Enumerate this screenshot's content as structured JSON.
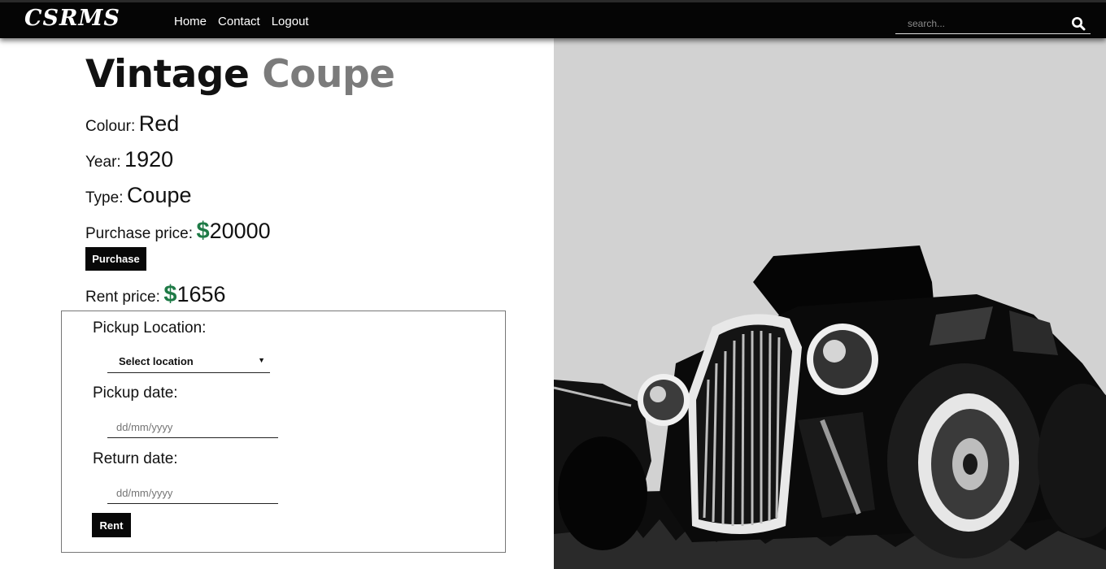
{
  "navbar": {
    "brand": "CSRMS",
    "links": [
      "Home",
      "Contact",
      "Logout"
    ],
    "search_placeholder": "search..."
  },
  "car": {
    "title_part1": "Vintage",
    "title_part2": "Coupe",
    "colour_label": "Colour:",
    "colour": "Red",
    "year_label": "Year:",
    "year": "1920",
    "type_label": "Type:",
    "type": "Coupe",
    "purchase_label": "Purchase price:",
    "currency": "$",
    "purchase_price": "20000",
    "purchase_button": "Purchase",
    "rent_label": "Rent price:",
    "rent_price": "1656"
  },
  "rent_form": {
    "pickup_location_label": "Pickup Location:",
    "location_selected": "Select location",
    "pickup_date_label": "Pickup date:",
    "pickup_date_placeholder": "dd/mm/yyyy",
    "return_date_label": "Return date:",
    "return_date_placeholder": "dd/mm/yyyy",
    "rent_button": "Rent"
  },
  "colors": {
    "navbar_bg": "#050505",
    "price_dollar": "#1e7a46",
    "title_secondary": "#7b7b7b",
    "photo_bg": "#d2d2d2"
  },
  "icons": {
    "search": "search-icon",
    "select_caret": "caret-down-icon"
  }
}
